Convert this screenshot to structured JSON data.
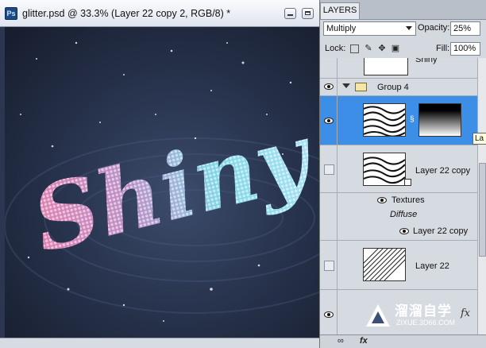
{
  "document": {
    "app_icon": "Ps",
    "title": "glitter.psd @ 33.3% (Layer 22 copy 2, RGB/8) *",
    "canvas_text": "Shiny",
    "status_zoom": "",
    "status_info": ""
  },
  "layers_panel": {
    "tab_label": "LAYERS",
    "blend_mode": "Multiply",
    "opacity_label": "Opacity:",
    "opacity_value": "25%",
    "lock_label": "Lock:",
    "fill_label": "Fill:",
    "fill_value": "100%",
    "tooltip": "La",
    "layers": [
      {
        "name": "Shiny",
        "visible": true
      },
      {
        "name": "Group 4",
        "visible": true
      },
      {
        "name": "",
        "visible": true,
        "selected": true
      },
      {
        "name": "Layer 22 copy",
        "visible": false
      },
      {
        "name": "Textures",
        "visible": true
      },
      {
        "name": "Diffuse",
        "visible": true
      },
      {
        "name": "Layer 22 copy",
        "visible": true
      },
      {
        "name": "Layer 22",
        "visible": false
      },
      {
        "name": "",
        "visible": true
      }
    ],
    "footer_fx": "fx"
  },
  "watermark": {
    "text": "溜溜自学",
    "url": "ZIXUE.3D66.COM",
    "fx": "fx"
  },
  "colors": {
    "selection": "#3d8ee6",
    "panel_bg": "#d4d8df",
    "canvas_bg": "#1c2436"
  }
}
